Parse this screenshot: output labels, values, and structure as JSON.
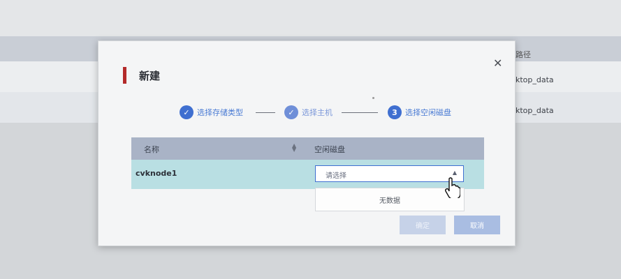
{
  "background": {
    "column_header": "路径",
    "rows": [
      "ktop_data",
      "ktop_data"
    ]
  },
  "dialog": {
    "title": "新建",
    "close_icon": "close-icon",
    "steps": [
      {
        "index": "1",
        "label": "选择存储类型",
        "state": "done"
      },
      {
        "index": "2",
        "label": "选择主机",
        "state": "done"
      },
      {
        "index": "3",
        "label": "选择空闲磁盘",
        "state": "active"
      }
    ],
    "table": {
      "columns": [
        "名称",
        "空闲磁盘"
      ],
      "rows": [
        {
          "name": "cvknode1",
          "disk_placeholder": "请选择"
        }
      ]
    },
    "dropdown_empty_text": "无数据",
    "buttons": {
      "confirm": "确定",
      "cancel": "取消"
    },
    "colors": {
      "accent": "#3f6fd0",
      "title_bar": "#b32a2a",
      "header_bg": "#a9b3c6",
      "row_bg": "#b9dfe3"
    }
  }
}
